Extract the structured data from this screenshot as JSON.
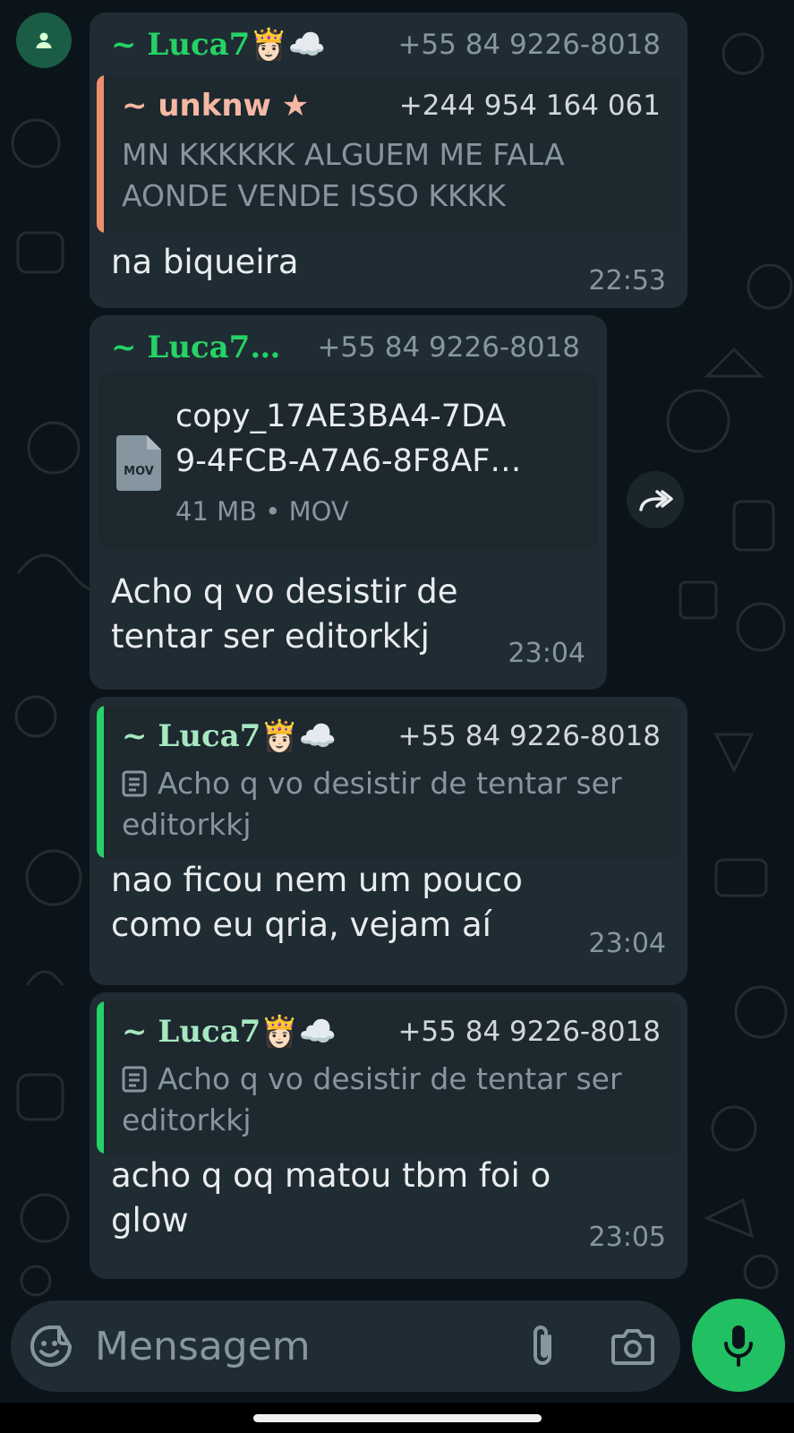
{
  "colors": {
    "accent_green": "#25d366",
    "mic_green": "#21c063",
    "bubble": "#202c33",
    "quote_bar_orange": "#f08f6e",
    "quote_bar_green": "#25d366",
    "quote_name_peach": "#f5b8a2",
    "quote_name_green": "#a6e8c0"
  },
  "messages": [
    {
      "sender_name": "~ Luca7👸🏻☁️",
      "sender_phone": "+55 84 9226-8018",
      "quote": {
        "name": "~ unknw ★",
        "phone": "+244 954 164 061",
        "text": "MN KKKKKK ALGUEM ME FALA AONDE VENDE ISSO KKKK"
      },
      "text": "na biqueira",
      "time": "22:53"
    },
    {
      "sender_name": "~ Luca7…",
      "sender_phone": "+55 84 9226-8018",
      "file": {
        "icon_label": "MOV",
        "name_line1": "copy_17AE3BA4-7DA",
        "name_line2": "9-4FCB-A7A6-8F8AF…",
        "meta": "41 MB • MOV"
      },
      "text": "Acho q vo desistir de tentar ser editorkkj",
      "time": "23:04"
    },
    {
      "quote": {
        "name": "~ Luca7👸🏻☁️",
        "phone": "+55 84 9226-8018",
        "text": "Acho q vo desistir de tentar ser editorkkj"
      },
      "text": "nao ficou nem um pouco como eu qria, vejam aí",
      "time": "23:04"
    },
    {
      "quote": {
        "name": "~ Luca7👸🏻☁️",
        "phone": "+55 84 9226-8018",
        "text": "Acho q vo desistir de tentar ser editorkkj"
      },
      "text": "acho q oq matou tbm foi o glow",
      "time": "23:05"
    }
  ],
  "composer": {
    "placeholder": "Mensagem",
    "icons": [
      "sticker-icon",
      "paperclip-icon",
      "camera-icon",
      "mic-icon"
    ]
  }
}
